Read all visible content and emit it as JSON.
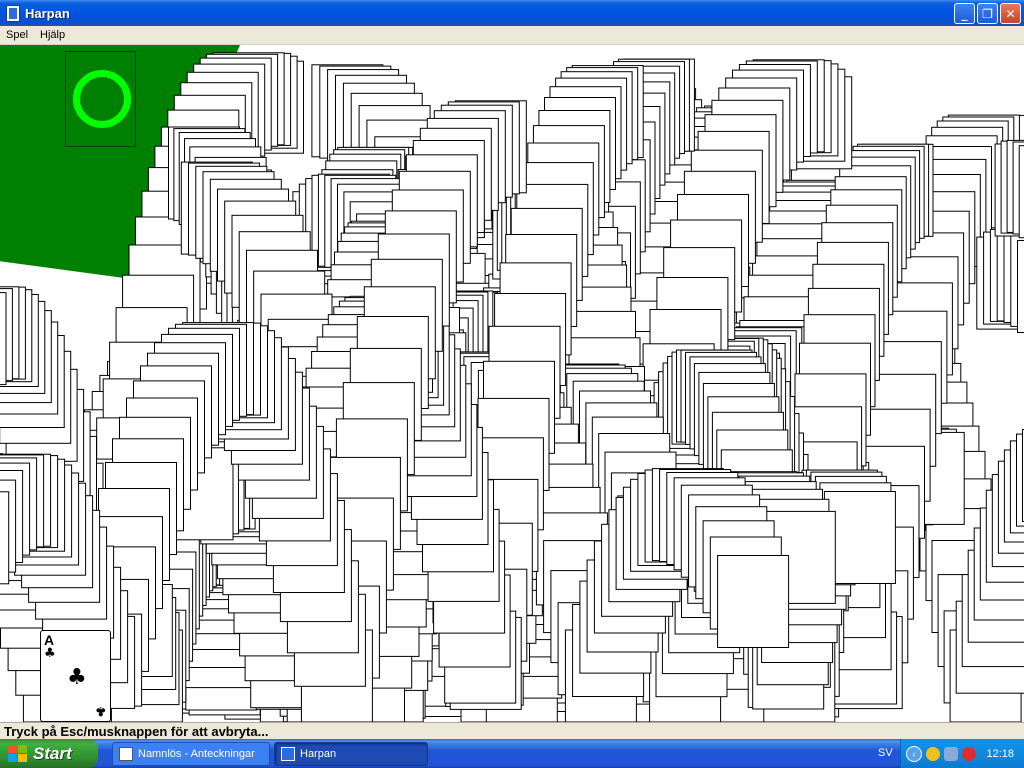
{
  "window": {
    "title": "Harpan",
    "minimize": "_",
    "maximize": "❐",
    "close": "✕"
  },
  "menu": {
    "items": [
      "Spel",
      "Hjälp"
    ]
  },
  "status": {
    "text": "Tryck på Esc/musknappen för att avbryta..."
  },
  "card": {
    "rank": "A",
    "suit": "♣"
  },
  "taskbar": {
    "start_label": "Start",
    "tasks": [
      {
        "label": "Namnlös - Anteckningar"
      },
      {
        "label": "Harpan"
      }
    ],
    "language": "SV",
    "clock": "12:18"
  },
  "colors": {
    "felt": "#008000",
    "highlight": "#00ff00",
    "title_blue": "#0054e3"
  }
}
